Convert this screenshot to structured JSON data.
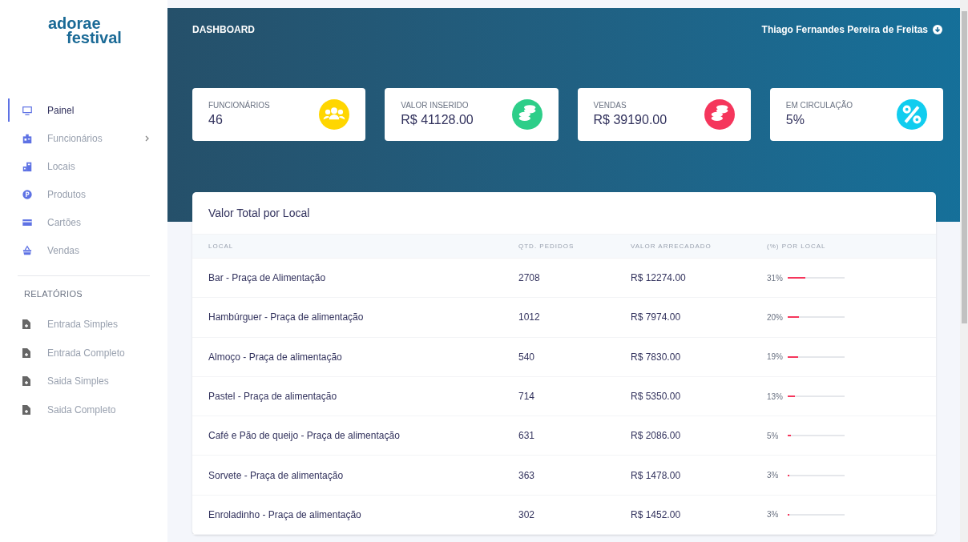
{
  "logo": {
    "line_1": "adorae",
    "line_2": "festival"
  },
  "sidebar": {
    "items": [
      {
        "label": "Painel",
        "kind": "monitor",
        "selected": true,
        "submenu": false
      },
      {
        "label": "Funcionários",
        "kind": "badge",
        "selected": false,
        "submenu": true
      },
      {
        "label": "Locais",
        "kind": "building",
        "selected": false,
        "submenu": false
      },
      {
        "label": "Produtos",
        "kind": "p",
        "selected": false,
        "submenu": false
      },
      {
        "label": "Cartões",
        "kind": "card",
        "selected": false,
        "submenu": false
      },
      {
        "label": "Vendas",
        "kind": "basket",
        "selected": false,
        "submenu": false
      }
    ],
    "section_title": "RELATÓRIOS",
    "reports": [
      "Entrada Simples",
      "Entrada Completo",
      "Saida Simples",
      "Saida Completo"
    ]
  },
  "header": {
    "title": "DASHBOARD",
    "user": "Thiago Fernandes Pereira de Freitas"
  },
  "stats": [
    {
      "label": "FUNCIONÁRIOS",
      "value": "46",
      "kind": "users",
      "color": "#ffd600"
    },
    {
      "label": "VALOR INSERIDO",
      "value": "R$ 41128.00",
      "kind": "coins",
      "color": "#2dce89"
    },
    {
      "label": "VENDAS",
      "value": "R$ 39190.00",
      "kind": "coins",
      "color": "#f5365c"
    },
    {
      "label": "EM CIRCULAÇÃO",
      "value": "5%",
      "kind": "percent",
      "color": "#11cdef"
    }
  ],
  "table": {
    "title": "Valor Total por Local",
    "columns": [
      "LOCAL",
      "QTD. PEDIDOS",
      "VALOR ARRECADADO",
      "(%) POR LOCAL"
    ],
    "rows": [
      {
        "local": "Bar - Praça de Alimentação",
        "orders": "2708",
        "value": "R$ 12274.00",
        "percent": "31%",
        "level": 0.31
      },
      {
        "local": "Hambúrguer - Praça de alimentação",
        "orders": "1012",
        "value": "R$ 7974.00",
        "percent": "20%",
        "level": 0.2
      },
      {
        "local": "Almoço - Praça de alimentação",
        "orders": "540",
        "value": "R$ 7830.00",
        "percent": "19%",
        "level": 0.19
      },
      {
        "local": "Pastel - Praça de alimentação",
        "orders": "714",
        "value": "R$ 5350.00",
        "percent": "13%",
        "level": 0.13
      },
      {
        "local": "Café e Pão de queijo - Praça de alimentação",
        "orders": "631",
        "value": "R$ 2086.00",
        "percent": "5%",
        "level": 0.05
      },
      {
        "local": "Sorvete - Praça de alimentação",
        "orders": "363",
        "value": "R$ 1478.00",
        "percent": "3%",
        "level": 0.03
      },
      {
        "local": "Enroladinho - Praça de alimentação",
        "orders": "302",
        "value": "R$ 1452.00",
        "percent": "3%",
        "level": 0.03
      }
    ]
  }
}
